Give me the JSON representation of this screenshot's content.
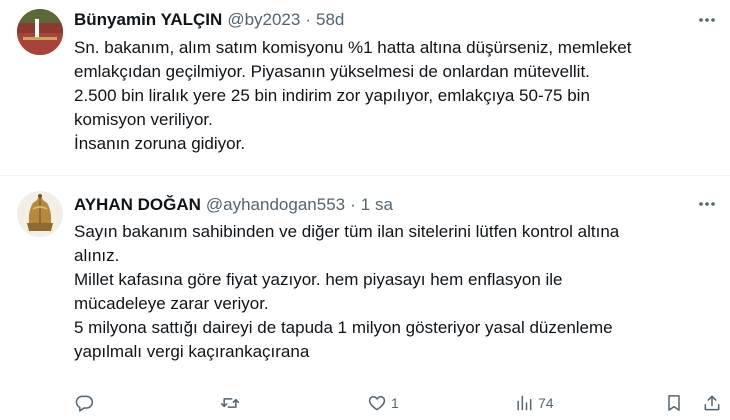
{
  "tweets": [
    {
      "author": {
        "name": "Bünyamin YALÇIN",
        "handle": "@by2023",
        "avatar_icon": "profile-photo-landscape"
      },
      "separator": "·",
      "time": "58d",
      "lines": [
        "Sn. bakanım, alım satım komisyonu %1 hatta altına düşürseniz, memleket",
        "emlakçıdan geçilmiyor. Piyasanın yükselmesi de onlardan mütevellit.",
        "2.500 bin liralık yere 25 bin indirim zor yapılıyor, emlakçıya 50-75 bin",
        "komisyon veriliyor.",
        "İnsanın zoruna gidiyor."
      ]
    },
    {
      "author": {
        "name": "AYHAN DOĞAN",
        "handle": "@ayhandogan553",
        "avatar_icon": "helmet-profile-photo"
      },
      "separator": "·",
      "time": "1 sa",
      "lines": [
        "Sayın bakanım sahibinden ve diğer tüm ilan sitelerini lütfen kontrol altına",
        "alınız.",
        "Millet kafasına göre fiyat yazıyor. hem piyasayı hem enflasyon ile",
        "mücadeleye zarar veriyor.",
        "5 milyona sattığı daireyi de tapuda 1 milyon gösteriyor yasal düzenleme",
        "yapılmalı vergi kaçırankaçırana"
      ],
      "actions": {
        "reply_count": "",
        "retweet_count": "",
        "like_count": "1",
        "views_count": "74"
      }
    }
  ],
  "icons": {
    "more": "more-horizontal-icon",
    "reply": "reply-bubble-icon",
    "retweet": "retweet-icon",
    "like": "heart-icon",
    "views": "views-bar-chart-icon",
    "bookmark": "bookmark-icon",
    "share": "share-upload-icon"
  },
  "colors": {
    "text_primary": "#0f1419",
    "text_secondary": "#536471",
    "divider": "#eff3f4"
  }
}
